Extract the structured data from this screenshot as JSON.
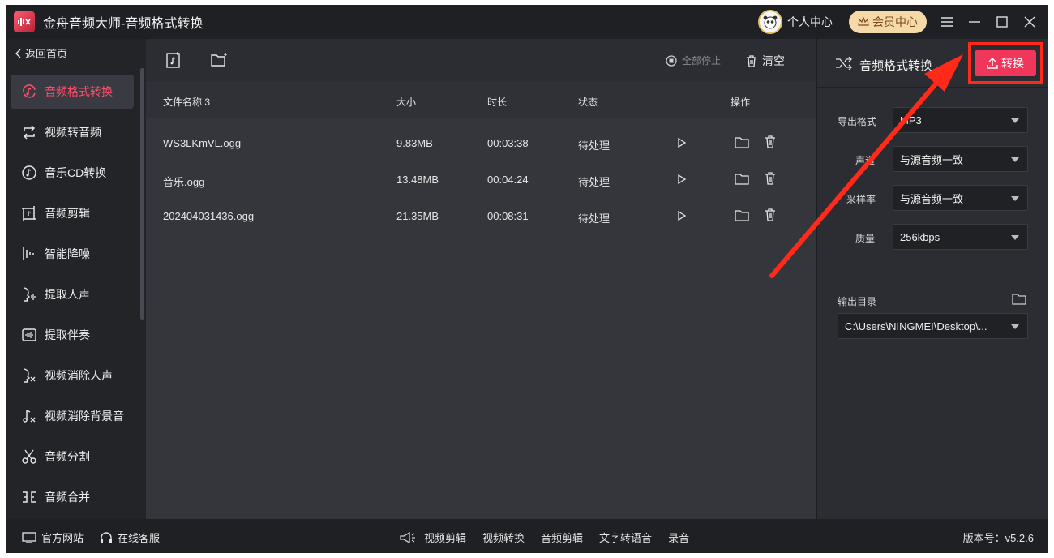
{
  "titlebar": {
    "title": "金舟音频大师-音频格式转换",
    "personal_center": "个人中心",
    "vip_center": "会员中心"
  },
  "sidebar": {
    "back": "返回首页",
    "items": [
      {
        "label": "音频格式转换",
        "icon": "music-convert-icon",
        "active": true
      },
      {
        "label": "视频转音频",
        "icon": "repeat-icon"
      },
      {
        "label": "音乐CD转换",
        "icon": "cd-icon"
      },
      {
        "label": "音频剪辑",
        "icon": "music-edit-icon"
      },
      {
        "label": "智能降噪",
        "icon": "waveform-icon"
      },
      {
        "label": "提取人声",
        "icon": "voice-icon"
      },
      {
        "label": "提取伴奏",
        "icon": "accompaniment-icon"
      },
      {
        "label": "视频消除人声",
        "icon": "voice-remove-icon"
      },
      {
        "label": "视频消除背景音",
        "icon": "note-remove-icon"
      },
      {
        "label": "音频分割",
        "icon": "scissors-icon"
      },
      {
        "label": "音频合并",
        "icon": "merge-icon"
      }
    ]
  },
  "toolbar": {
    "stop_all": "全部停止",
    "clear": "清空"
  },
  "table": {
    "headers": {
      "name": "文件名称 3",
      "size": "大小",
      "duration": "时长",
      "status": "状态",
      "actions": "操作"
    },
    "rows": [
      {
        "name": "WS3LKmVL.ogg",
        "size": "9.83MB",
        "duration": "00:03:38",
        "status": "待处理"
      },
      {
        "name": "音乐.ogg",
        "size": "13.48MB",
        "duration": "00:04:24",
        "status": "待处理"
      },
      {
        "name": "202404031436.ogg",
        "size": "21.35MB",
        "duration": "00:08:31",
        "status": "待处理"
      }
    ]
  },
  "right_panel": {
    "title": "音频格式转换",
    "convert_button": "转换",
    "fields": [
      {
        "label": "导出格式",
        "value": "MP3"
      },
      {
        "label": "声道",
        "value": "与源音频一致"
      },
      {
        "label": "采样率",
        "value": "与源音频一致"
      },
      {
        "label": "质量",
        "value": "256kbps"
      }
    ],
    "output_dir_label": "输出目录",
    "output_dir_value": "C:\\Users\\NINGMEI\\Desktop\\..."
  },
  "footer": {
    "website": "官方网站",
    "support": "在线客服",
    "links": [
      "视频剪辑",
      "视频转换",
      "音频剪辑",
      "文字转语音",
      "录音"
    ],
    "version": "版本号：v5.2.6"
  },
  "colors": {
    "accent": "#f0365a",
    "annotation": "#ff2a1a",
    "vip_bg": "#f6d9a9"
  }
}
